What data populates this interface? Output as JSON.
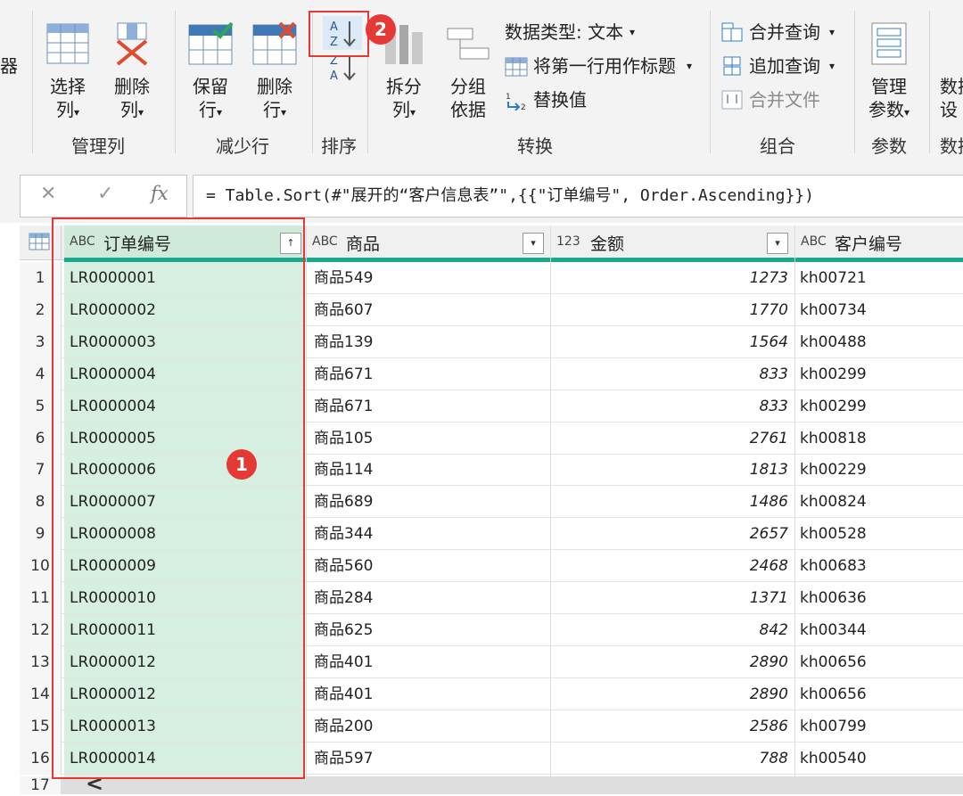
{
  "ribbon": {
    "left_cut": "器",
    "select_col": {
      "line1": "选择",
      "line2": "列"
    },
    "remove_col": {
      "line1": "删除",
      "line2": "列"
    },
    "keep_rows": {
      "line1": "保留",
      "line2": "行"
    },
    "remove_rows": {
      "line1": "删除",
      "line2": "行"
    },
    "split_col": {
      "line1": "拆分",
      "line2": "列"
    },
    "group_by": {
      "line1": "分组",
      "line2": "依据"
    },
    "data_type": "数据类型: 文本",
    "first_row_header": "将第一行用作标题",
    "replace_values": "替换值",
    "merge_queries": "合并查询",
    "append_queries": "追加查询",
    "combine_files": "合并文件",
    "manage_params": {
      "line1": "管理",
      "line2": "参数"
    },
    "data_source": {
      "line1": "数据",
      "line2": "设"
    },
    "dropdown_glyph": "▾",
    "groups": {
      "manage_columns": "管理列",
      "reduce_rows": "减少行",
      "sort": "排序",
      "transform": "转换",
      "combine": "组合",
      "params": "参数",
      "data_cut": "数据"
    }
  },
  "formula": {
    "cancel": "✕",
    "confirm": "✓",
    "fx": "fx",
    "expression": "= Table.Sort(#\"展开的“客户信息表”\",{{\"订单编号\", Order.Ascending}})"
  },
  "table": {
    "columns": [
      {
        "type": "ABC",
        "name": "订单编号",
        "filter": "↑"
      },
      {
        "type": "ABC",
        "name": "商品",
        "filter": "▾"
      },
      {
        "type": "123",
        "name": "金额",
        "filter": "▾"
      },
      {
        "type": "ABC",
        "name": "客户编号"
      }
    ],
    "rows": [
      {
        "n": "1",
        "id": "LR0000001",
        "product": "商品549",
        "amount": "1273",
        "cust": "kh00721"
      },
      {
        "n": "2",
        "id": "LR0000002",
        "product": "商品607",
        "amount": "1770",
        "cust": "kh00734"
      },
      {
        "n": "3",
        "id": "LR0000003",
        "product": "商品139",
        "amount": "1564",
        "cust": "kh00488"
      },
      {
        "n": "4",
        "id": "LR0000004",
        "product": "商品671",
        "amount": "833",
        "cust": "kh00299"
      },
      {
        "n": "5",
        "id": "LR0000004",
        "product": "商品671",
        "amount": "833",
        "cust": "kh00299"
      },
      {
        "n": "6",
        "id": "LR0000005",
        "product": "商品105",
        "amount": "2761",
        "cust": "kh00818"
      },
      {
        "n": "7",
        "id": "LR0000006",
        "product": "商品114",
        "amount": "1813",
        "cust": "kh00229"
      },
      {
        "n": "8",
        "id": "LR0000007",
        "product": "商品689",
        "amount": "1486",
        "cust": "kh00824"
      },
      {
        "n": "9",
        "id": "LR0000008",
        "product": "商品344",
        "amount": "2657",
        "cust": "kh00528"
      },
      {
        "n": "10",
        "id": "LR0000009",
        "product": "商品560",
        "amount": "2468",
        "cust": "kh00683"
      },
      {
        "n": "11",
        "id": "LR0000010",
        "product": "商品284",
        "amount": "1371",
        "cust": "kh00636"
      },
      {
        "n": "12",
        "id": "LR0000011",
        "product": "商品625",
        "amount": "842",
        "cust": "kh00344"
      },
      {
        "n": "13",
        "id": "LR0000012",
        "product": "商品401",
        "amount": "2890",
        "cust": "kh00656"
      },
      {
        "n": "14",
        "id": "LR0000012",
        "product": "商品401",
        "amount": "2890",
        "cust": "kh00656"
      },
      {
        "n": "15",
        "id": "LR0000013",
        "product": "商品200",
        "amount": "2586",
        "cust": "kh00799"
      },
      {
        "n": "16",
        "id": "LR0000014",
        "product": "商品597",
        "amount": "788",
        "cust": "kh00540"
      }
    ],
    "next_row_num": "17",
    "scroll_left": "<"
  },
  "annotations": {
    "one": "1",
    "two": "2"
  },
  "colors": {
    "accent_red": "#e53935",
    "selected_col": "#d6efe1",
    "quality_bar": "#1aa88f"
  }
}
